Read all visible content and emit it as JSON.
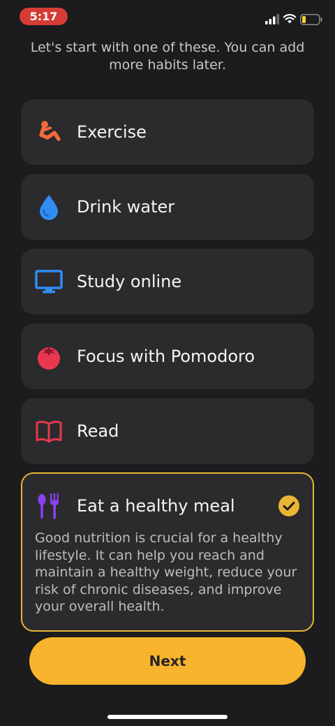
{
  "status_bar": {
    "time": "5:17",
    "icons": [
      "signal-icon",
      "wifi-icon",
      "battery-icon"
    ]
  },
  "subtitle": "Let's start with one of these. You can add more habits later.",
  "habits": [
    {
      "label": "Exercise",
      "icon": "exercise-icon",
      "color": "#f26b3a"
    },
    {
      "label": "Drink water",
      "icon": "water-drop-icon",
      "color": "#2f8df4"
    },
    {
      "label": "Study online",
      "icon": "monitor-icon",
      "color": "#2f8df4"
    },
    {
      "label": "Focus with Pomodoro",
      "icon": "tomato-icon",
      "color": "#e8384f"
    },
    {
      "label": "Read",
      "icon": "book-icon",
      "color": "#e8384f"
    }
  ],
  "selected_habit": {
    "label": "Eat a healthy meal",
    "icon": "utensils-icon",
    "color": "#8a3ff0",
    "description": "Good nutrition is crucial for a healthy lifestyle. It can help you reach and maintain a healthy weight, reduce your risk of chronic diseases, and improve your overall health.",
    "checked": true,
    "accent": "#e9b634"
  },
  "next_button": {
    "label": "Next",
    "color": "#f7b42c"
  }
}
